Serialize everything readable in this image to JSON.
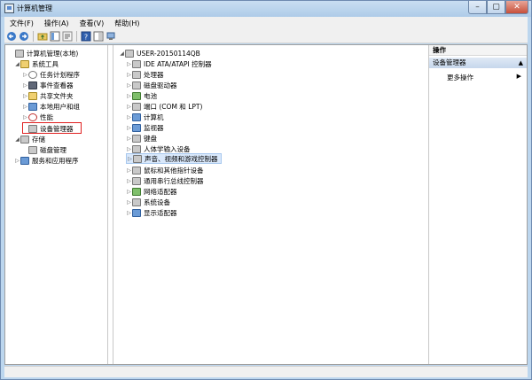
{
  "window": {
    "title": "计算机管理",
    "minimize": "–",
    "maximize": "▢",
    "close": "✕"
  },
  "menu": [
    "文件(F)",
    "操作(A)",
    "查看(V)",
    "帮助(H)"
  ],
  "left_tree": [
    {
      "label": "计算机管理(本地)",
      "icon": "computer-management-icon",
      "indent": 0,
      "arrow": ""
    },
    {
      "label": "系统工具",
      "icon": "tools-icon",
      "indent": 1,
      "arrow": "◢"
    },
    {
      "label": "任务计划程序",
      "icon": "clock-icon",
      "indent": 2,
      "arrow": "▷"
    },
    {
      "label": "事件查看器",
      "icon": "event-viewer-icon",
      "indent": 2,
      "arrow": "▷"
    },
    {
      "label": "共享文件夹",
      "icon": "shared-folder-icon",
      "indent": 2,
      "arrow": "▷"
    },
    {
      "label": "本地用户和组",
      "icon": "users-icon",
      "indent": 2,
      "arrow": "▷"
    },
    {
      "label": "性能",
      "icon": "performance-icon",
      "indent": 2,
      "arrow": "▷"
    },
    {
      "label": "设备管理器",
      "icon": "device-manager-icon",
      "indent": 2,
      "arrow": ""
    },
    {
      "label": "存储",
      "icon": "storage-icon",
      "indent": 1,
      "arrow": "◢"
    },
    {
      "label": "磁盘管理",
      "icon": "disk-icon",
      "indent": 2,
      "arrow": ""
    },
    {
      "label": "服务和应用程序",
      "icon": "services-icon",
      "indent": 1,
      "arrow": "▷"
    }
  ],
  "device_tree": {
    "root": "USER-20150114QB",
    "items": [
      {
        "label": "IDE ATA/ATAPI 控制器",
        "icon": "ide-controller-icon"
      },
      {
        "label": "处理器",
        "icon": "processor-icon"
      },
      {
        "label": "磁盘驱动器",
        "icon": "disk-drive-icon"
      },
      {
        "label": "电池",
        "icon": "battery-icon"
      },
      {
        "label": "端口 (COM 和 LPT)",
        "icon": "port-icon"
      },
      {
        "label": "计算机",
        "icon": "computer-icon"
      },
      {
        "label": "监视器",
        "icon": "monitor-icon"
      },
      {
        "label": "键盘",
        "icon": "keyboard-icon"
      },
      {
        "label": "人体学输入设备",
        "icon": "hid-icon"
      },
      {
        "label": "声音、视频和游戏控制器",
        "icon": "sound-icon"
      },
      {
        "label": "鼠标和其他指针设备",
        "icon": "mouse-icon"
      },
      {
        "label": "通用串行总线控制器",
        "icon": "usb-icon"
      },
      {
        "label": "网络适配器",
        "icon": "network-icon"
      },
      {
        "label": "系统设备",
        "icon": "system-device-icon"
      },
      {
        "label": "显示适配器",
        "icon": "display-adapter-icon"
      }
    ]
  },
  "actions": {
    "header": "操作",
    "section": "设备管理器",
    "more": "更多操作"
  }
}
